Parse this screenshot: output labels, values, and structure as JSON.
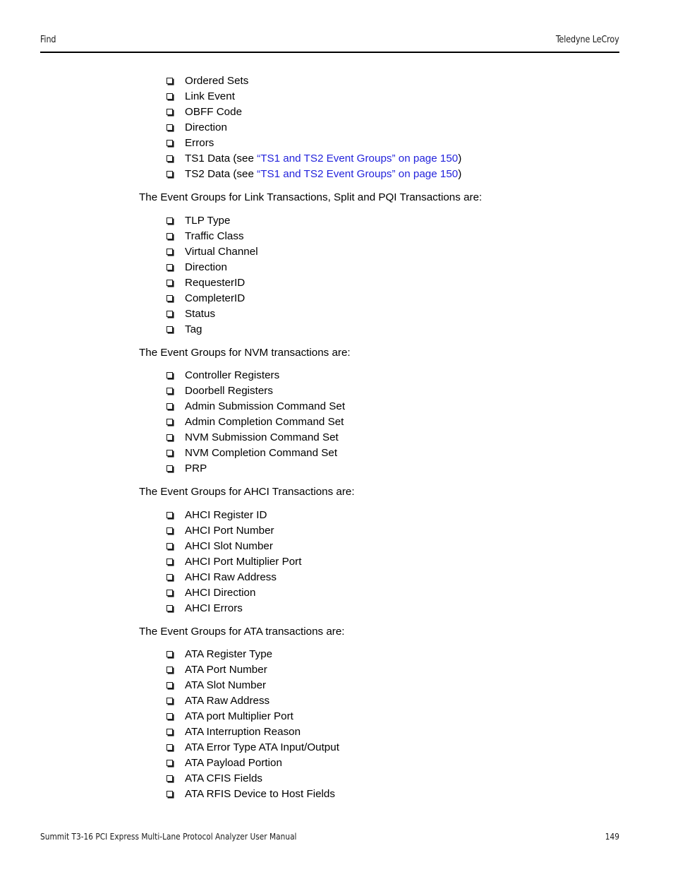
{
  "header": {
    "left": "Find",
    "right": "Teledyne LeCroy"
  },
  "footer": {
    "left": "Summit T3-16 PCI Express Multi-Lane Protocol Analyzer User Manual",
    "right": "149"
  },
  "colors": {
    "link": "#2323dc",
    "text": "#000000",
    "rule": "#000000"
  },
  "sections": [
    {
      "lead": null,
      "items": [
        {
          "text": "Ordered Sets"
        },
        {
          "text": "Link Event"
        },
        {
          "text": "OBFF Code"
        },
        {
          "text": "Direction"
        },
        {
          "text": "Errors"
        },
        {
          "prefix": "TS1 Data (see ",
          "link": "“TS1 and TS2 Event Groups” on page 150",
          "suffix": ")"
        },
        {
          "prefix": "TS2 Data (see ",
          "link": "“TS1 and TS2 Event Groups” on page 150",
          "suffix": ")"
        }
      ]
    },
    {
      "lead": "The Event Groups for Link Transactions, Split and PQI Transactions are:",
      "items": [
        {
          "text": "TLP Type"
        },
        {
          "text": "Traffic Class"
        },
        {
          "text": "Virtual Channel"
        },
        {
          "text": "Direction"
        },
        {
          "text": "RequesterID"
        },
        {
          "text": "CompleterID"
        },
        {
          "text": "Status"
        },
        {
          "text": "Tag"
        }
      ]
    },
    {
      "lead": "The Event Groups for NVM transactions are:",
      "items": [
        {
          "text": "Controller Registers"
        },
        {
          "text": "Doorbell Registers"
        },
        {
          "text": "Admin Submission Command Set"
        },
        {
          "text": "Admin Completion Command Set"
        },
        {
          "text": "NVM Submission Command Set"
        },
        {
          "text": "NVM Completion Command Set"
        },
        {
          "text": "PRP"
        }
      ]
    },
    {
      "lead": "The Event Groups for AHCI Transactions are:",
      "items": [
        {
          "text": "AHCI Register ID"
        },
        {
          "text": "AHCI Port Number"
        },
        {
          "text": "AHCI Slot Number"
        },
        {
          "text": "AHCI Port Multiplier Port"
        },
        {
          "text": "AHCI Raw Address"
        },
        {
          "text": "AHCI Direction"
        },
        {
          "text": "AHCI Errors"
        }
      ]
    },
    {
      "lead": "The Event Groups for ATA transactions are:",
      "items": [
        {
          "text": "ATA Register Type"
        },
        {
          "text": "ATA Port Number"
        },
        {
          "text": "ATA Slot Number"
        },
        {
          "text": "ATA Raw Address"
        },
        {
          "text": "ATA port Multiplier Port"
        },
        {
          "text": "ATA Interruption Reason"
        },
        {
          "text": "ATA Error Type ATA Input/Output"
        },
        {
          "text": "ATA Payload Portion"
        },
        {
          "text": "ATA CFIS Fields"
        },
        {
          "text": "ATA RFIS Device to Host Fields"
        }
      ]
    }
  ]
}
